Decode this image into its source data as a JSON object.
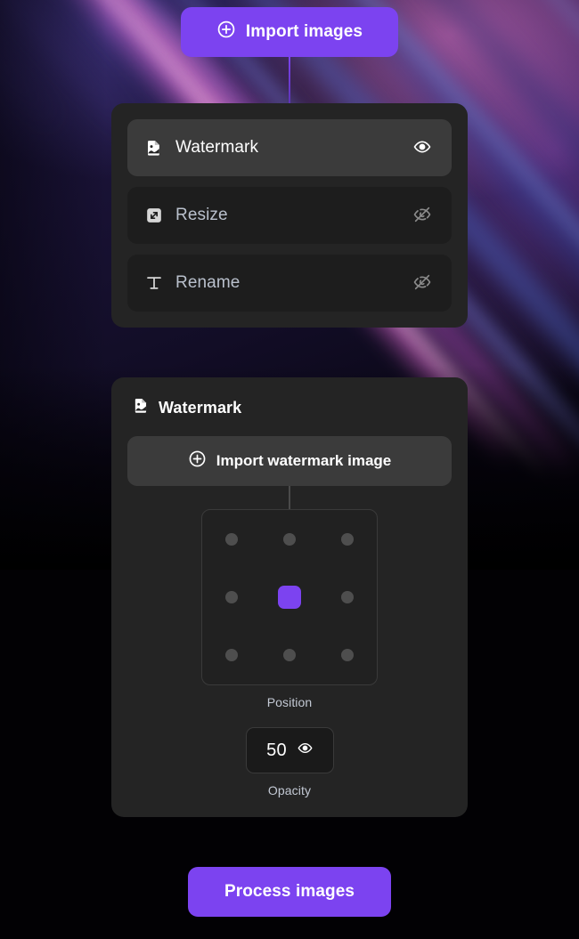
{
  "theme": {
    "accent": "#7c43f0",
    "card_bg": "#242424",
    "row_bg": "#1d1d1d",
    "row_active_bg": "#3b3b3b",
    "page_bg": "#000000",
    "text_primary": "#ffffff",
    "text_muted": "#b9c0cc"
  },
  "import_button": {
    "label": "Import images",
    "icon": "plus-circle-icon"
  },
  "operations": {
    "items": [
      {
        "label": "Watermark",
        "icon": "image-file-icon",
        "active": true,
        "visible": true,
        "toggle_icon": "eye-icon"
      },
      {
        "label": "Resize",
        "icon": "resize-arrow-icon",
        "active": false,
        "visible": false,
        "toggle_icon": "eye-off-icon"
      },
      {
        "label": "Rename",
        "icon": "text-t-icon",
        "active": false,
        "visible": false,
        "toggle_icon": "eye-off-icon"
      }
    ]
  },
  "watermark_panel": {
    "title": "Watermark",
    "title_icon": "image-file-icon",
    "import_button": {
      "label": "Import watermark image",
      "icon": "plus-circle-icon"
    },
    "position": {
      "caption": "Position",
      "selected_index": 4,
      "cells": [
        "top-left",
        "top-center",
        "top-right",
        "middle-left",
        "center",
        "middle-right",
        "bottom-left",
        "bottom-center",
        "bottom-right"
      ]
    },
    "opacity": {
      "caption": "Opacity",
      "value": "50",
      "icon": "eye-icon"
    }
  },
  "process_button": {
    "label": "Process images"
  }
}
